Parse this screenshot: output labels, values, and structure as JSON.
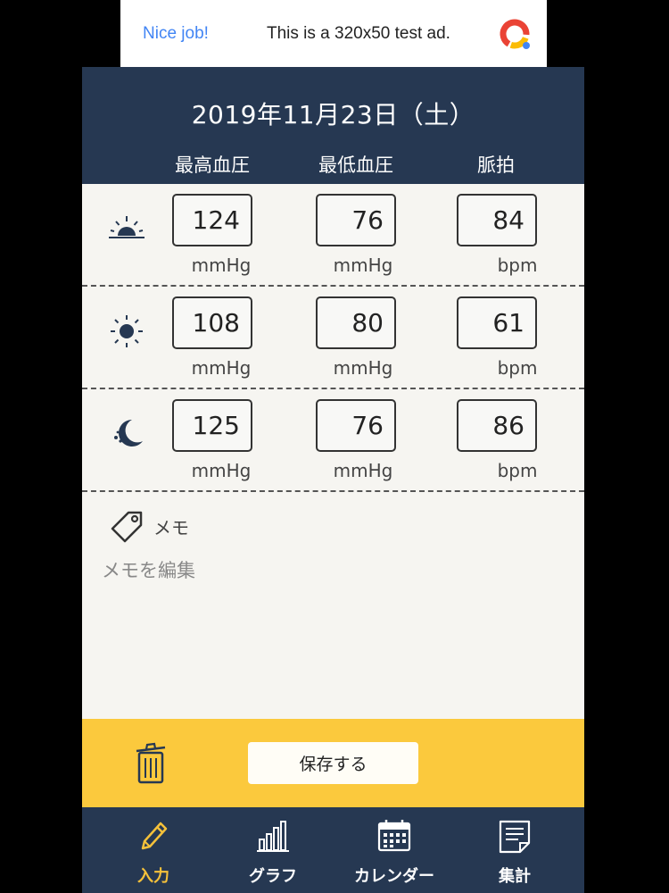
{
  "ad": {
    "nice": "Nice job!",
    "text": "This is a 320x50 test ad."
  },
  "header": {
    "date": "2019年11月23日（土）",
    "columns": [
      "最高血圧",
      "最低血圧",
      "脈拍"
    ]
  },
  "readings": [
    {
      "period_icon": "sunrise-icon",
      "systolic": "124",
      "diastolic": "76",
      "pulse": "84",
      "unit_bp": "mmHg",
      "unit_pulse": "bpm"
    },
    {
      "period_icon": "sun-icon",
      "systolic": "108",
      "diastolic": "80",
      "pulse": "61",
      "unit_bp": "mmHg",
      "unit_pulse": "bpm"
    },
    {
      "period_icon": "moon-icon",
      "systolic": "125",
      "diastolic": "76",
      "pulse": "86",
      "unit_bp": "mmHg",
      "unit_pulse": "bpm"
    }
  ],
  "memo": {
    "label": "メモ",
    "placeholder": "メモを編集"
  },
  "actions": {
    "save_label": "保存する"
  },
  "tabs": [
    {
      "label": "入力",
      "icon": "pencil-icon",
      "active": true
    },
    {
      "label": "グラフ",
      "icon": "bar-chart-icon",
      "active": false
    },
    {
      "label": "カレンダー",
      "icon": "calendar-icon",
      "active": false
    },
    {
      "label": "集計",
      "icon": "document-icon",
      "active": false
    }
  ],
  "colors": {
    "navy": "#263852",
    "yellow": "#fbc93d",
    "active_tab": "#f5c13a",
    "background": "#f6f5f1"
  }
}
